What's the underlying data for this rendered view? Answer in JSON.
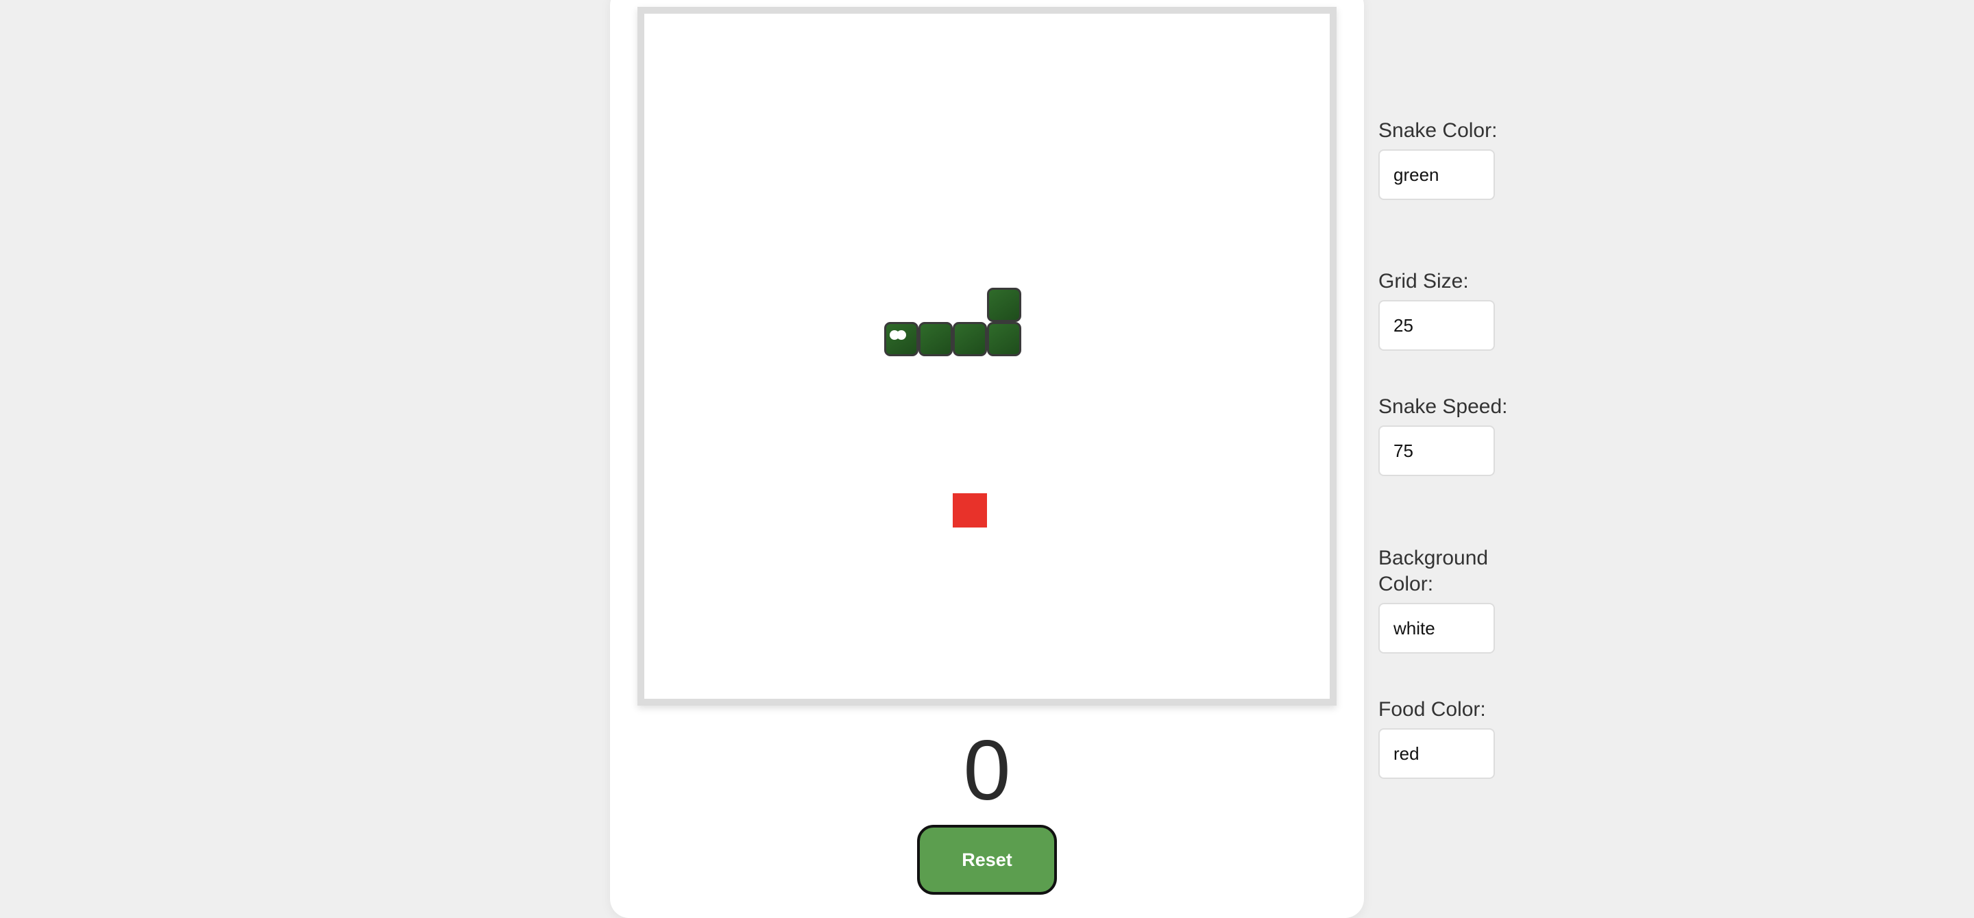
{
  "game": {
    "score": "0",
    "reset_label": "Reset",
    "grid_cells": 20,
    "snake_color": "#2f6b2a",
    "food_color": "#e8322a",
    "board_background": "#ffffff",
    "snake": [
      {
        "col": 7,
        "row": 9,
        "head": true
      },
      {
        "col": 8,
        "row": 9
      },
      {
        "col": 9,
        "row": 9
      },
      {
        "col": 10,
        "row": 9
      },
      {
        "col": 10,
        "row": 8
      }
    ],
    "food": {
      "col": 9,
      "row": 14
    }
  },
  "settings": {
    "snake_color": {
      "label": "Snake Color:",
      "value": "green"
    },
    "grid_size": {
      "label": "Grid Size:",
      "value": "25"
    },
    "snake_speed": {
      "label": "Snake Speed:",
      "value": "75"
    },
    "background_color": {
      "label": "Background Color:",
      "value": "white"
    },
    "food_color": {
      "label": "Food Color:",
      "value": "red"
    }
  }
}
